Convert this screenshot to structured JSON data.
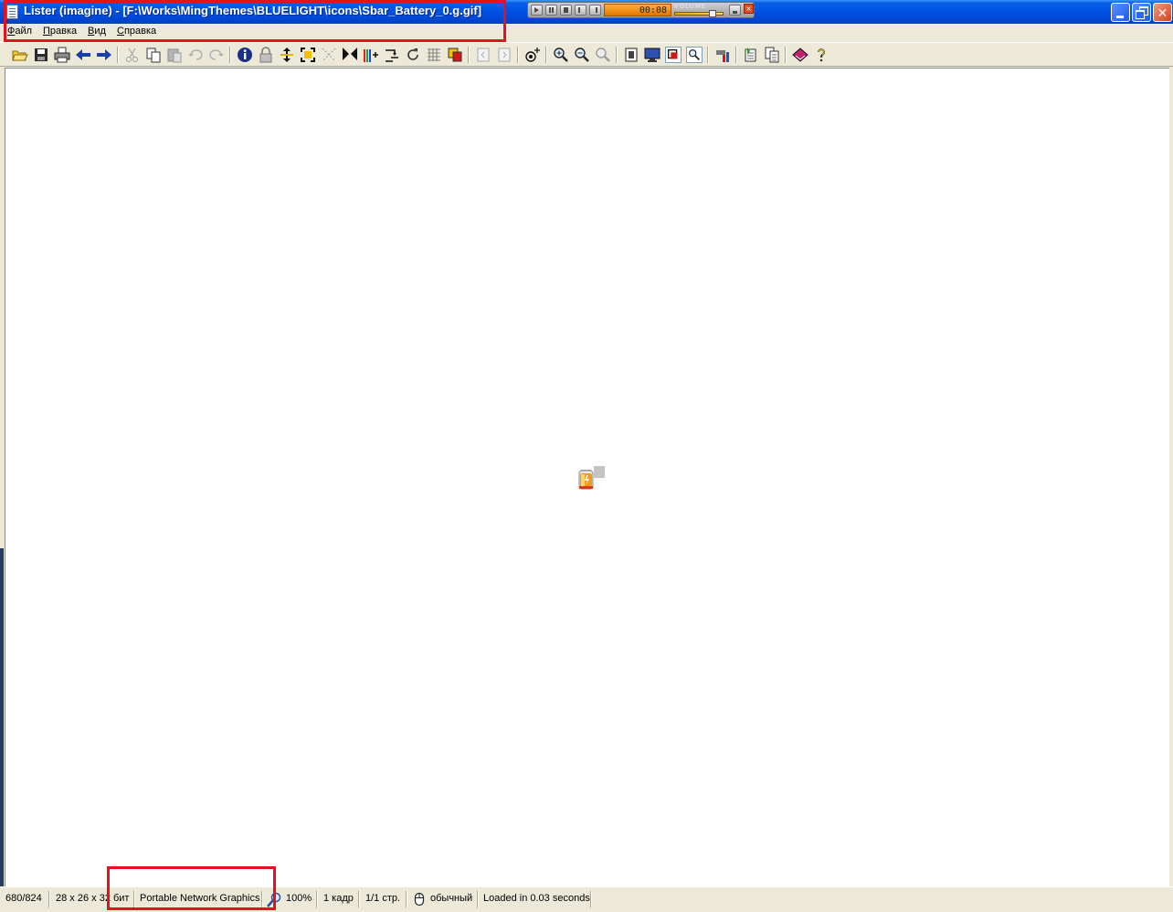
{
  "window": {
    "title": "Lister (imagine) - [F:\\Works\\MingThemes\\BLUELIGHT\\icons\\Sbar_Battery_0.g.gif]"
  },
  "player": {
    "time": "00:08",
    "volume_label": "VOLUME",
    "volume_level": 0.85
  },
  "menu": {
    "items": [
      "Файл",
      "Правка",
      "Вид",
      "Справка"
    ]
  },
  "toolbar": {
    "buttons": [
      "open-icon",
      "save-icon",
      "print-icon",
      "back-icon",
      "forward-icon",
      "cut-icon",
      "copy-icon",
      "paste-icon",
      "undo-icon",
      "redo-icon",
      "info-icon",
      "lock-icon",
      "flip-vertical-icon",
      "resize-icon",
      "crop-icon",
      "select-icon",
      "levels-icon",
      "rotate-icon",
      "refresh-icon",
      "grid-icon",
      "color-icon",
      "prev-page-icon",
      "next-page-icon",
      "eye-icon",
      "zoom-in-icon",
      "zoom-out-icon",
      "zoom-fit-icon",
      "fullscreen-icon",
      "monitor-icon",
      "actual-size-icon",
      "magnifier-icon",
      "tools-icon",
      "batch-icon",
      "multi-copy-icon",
      "book-icon",
      "help-icon"
    ]
  },
  "status": {
    "position": "680/824",
    "dimensions": "28 x 26 x 32 бит",
    "format": "Portable Network Graphics",
    "zoom": "100%",
    "frames": "1 кадр",
    "pages": "1/1 стр.",
    "mode": "обычный",
    "load_time": "Loaded in 0.03 seconds"
  },
  "colors": {
    "titlebar": "#0055e5",
    "highlight": "#e8101a",
    "player_display": "#f08c10"
  }
}
